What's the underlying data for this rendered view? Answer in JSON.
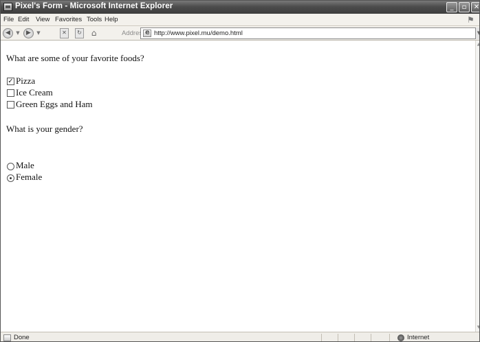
{
  "window": {
    "title": "Pixel's Form - Microsoft Internet Explorer",
    "minimize_glyph": "_",
    "maximize_glyph": "▫",
    "close_glyph": "✕"
  },
  "menu": {
    "items": [
      "File",
      "Edit",
      "View",
      "Favorites",
      "Tools",
      "Help"
    ]
  },
  "toolbar": {
    "back_glyph": "◀",
    "back_dropdown_glyph": "▼",
    "forward_glyph": "▶",
    "forward_dropdown_glyph": "▼",
    "stop_glyph": "✕",
    "refresh_glyph": "↻",
    "home_glyph": "⌂",
    "address_label": "Address",
    "url": "http://www.pixel.mu/demo.html",
    "address_dropdown_glyph": "▼"
  },
  "form": {
    "question1": "What are some of your favorite foods?",
    "foods": [
      {
        "label": "Pizza",
        "checked": true
      },
      {
        "label": "Ice Cream",
        "checked": false
      },
      {
        "label": "Green Eggs and Ham",
        "checked": false
      }
    ],
    "question2": "What is your gender?",
    "genders": [
      {
        "label": "Male",
        "selected": false
      },
      {
        "label": "Female",
        "selected": true
      }
    ],
    "check_glyph": "✓"
  },
  "scrollbar": {
    "up_glyph": "▲",
    "down_glyph": "▼"
  },
  "status": {
    "text": "Done",
    "zone": "Internet"
  },
  "colors": {
    "titlebar": "#4d4d4d",
    "chrome": "#ece9e4",
    "content_bg": "#ffffff"
  }
}
